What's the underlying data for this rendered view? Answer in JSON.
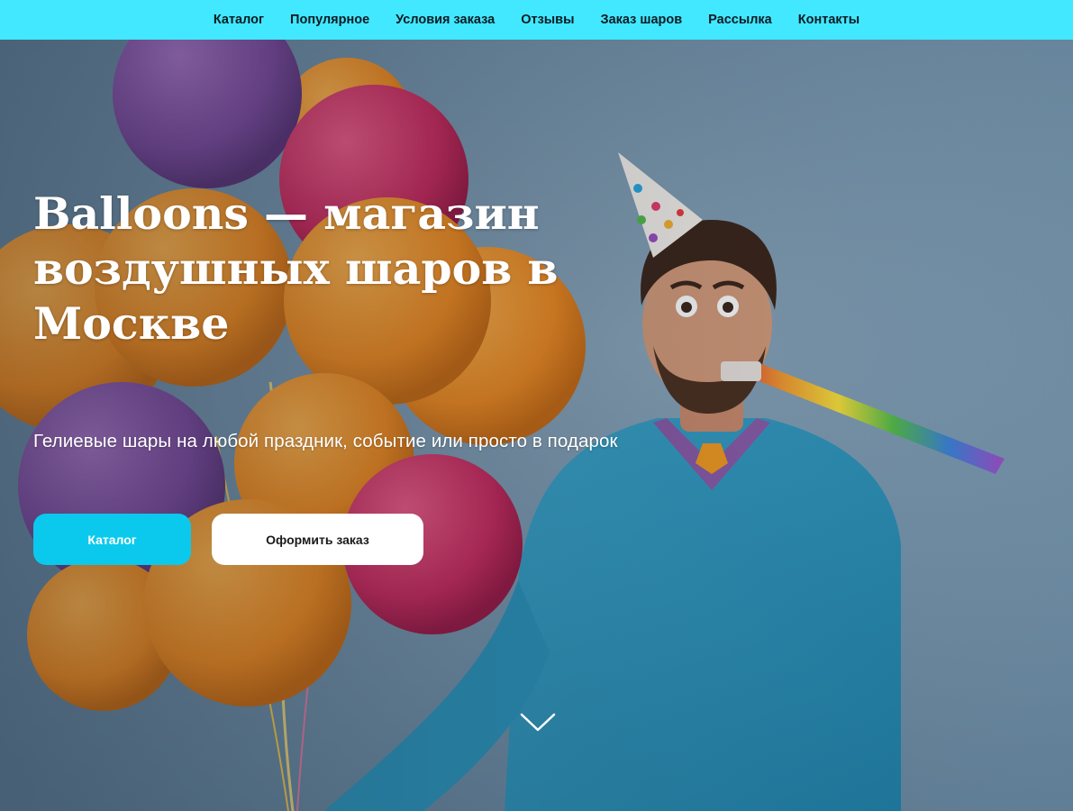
{
  "nav": {
    "items": [
      "Каталог",
      "Популярное",
      "Условия заказа",
      "Отзывы",
      "Заказ шаров",
      "Рассылка",
      "Контакты"
    ]
  },
  "hero": {
    "title": "Balloons — магазин воздушных шаров в Москве",
    "subtitle": "Гелиевые шары на любой праздник, событие или просто в подарок",
    "catalog_button": "Каталог",
    "order_button": "Оформить заказ"
  },
  "colors": {
    "nav_background": "#41e8ff",
    "catalog_button": "#0bc9ec",
    "order_button": "#ffffff",
    "hero_background": "#6f8ea6"
  },
  "icons": {
    "scroll": "chevron-down-icon"
  }
}
